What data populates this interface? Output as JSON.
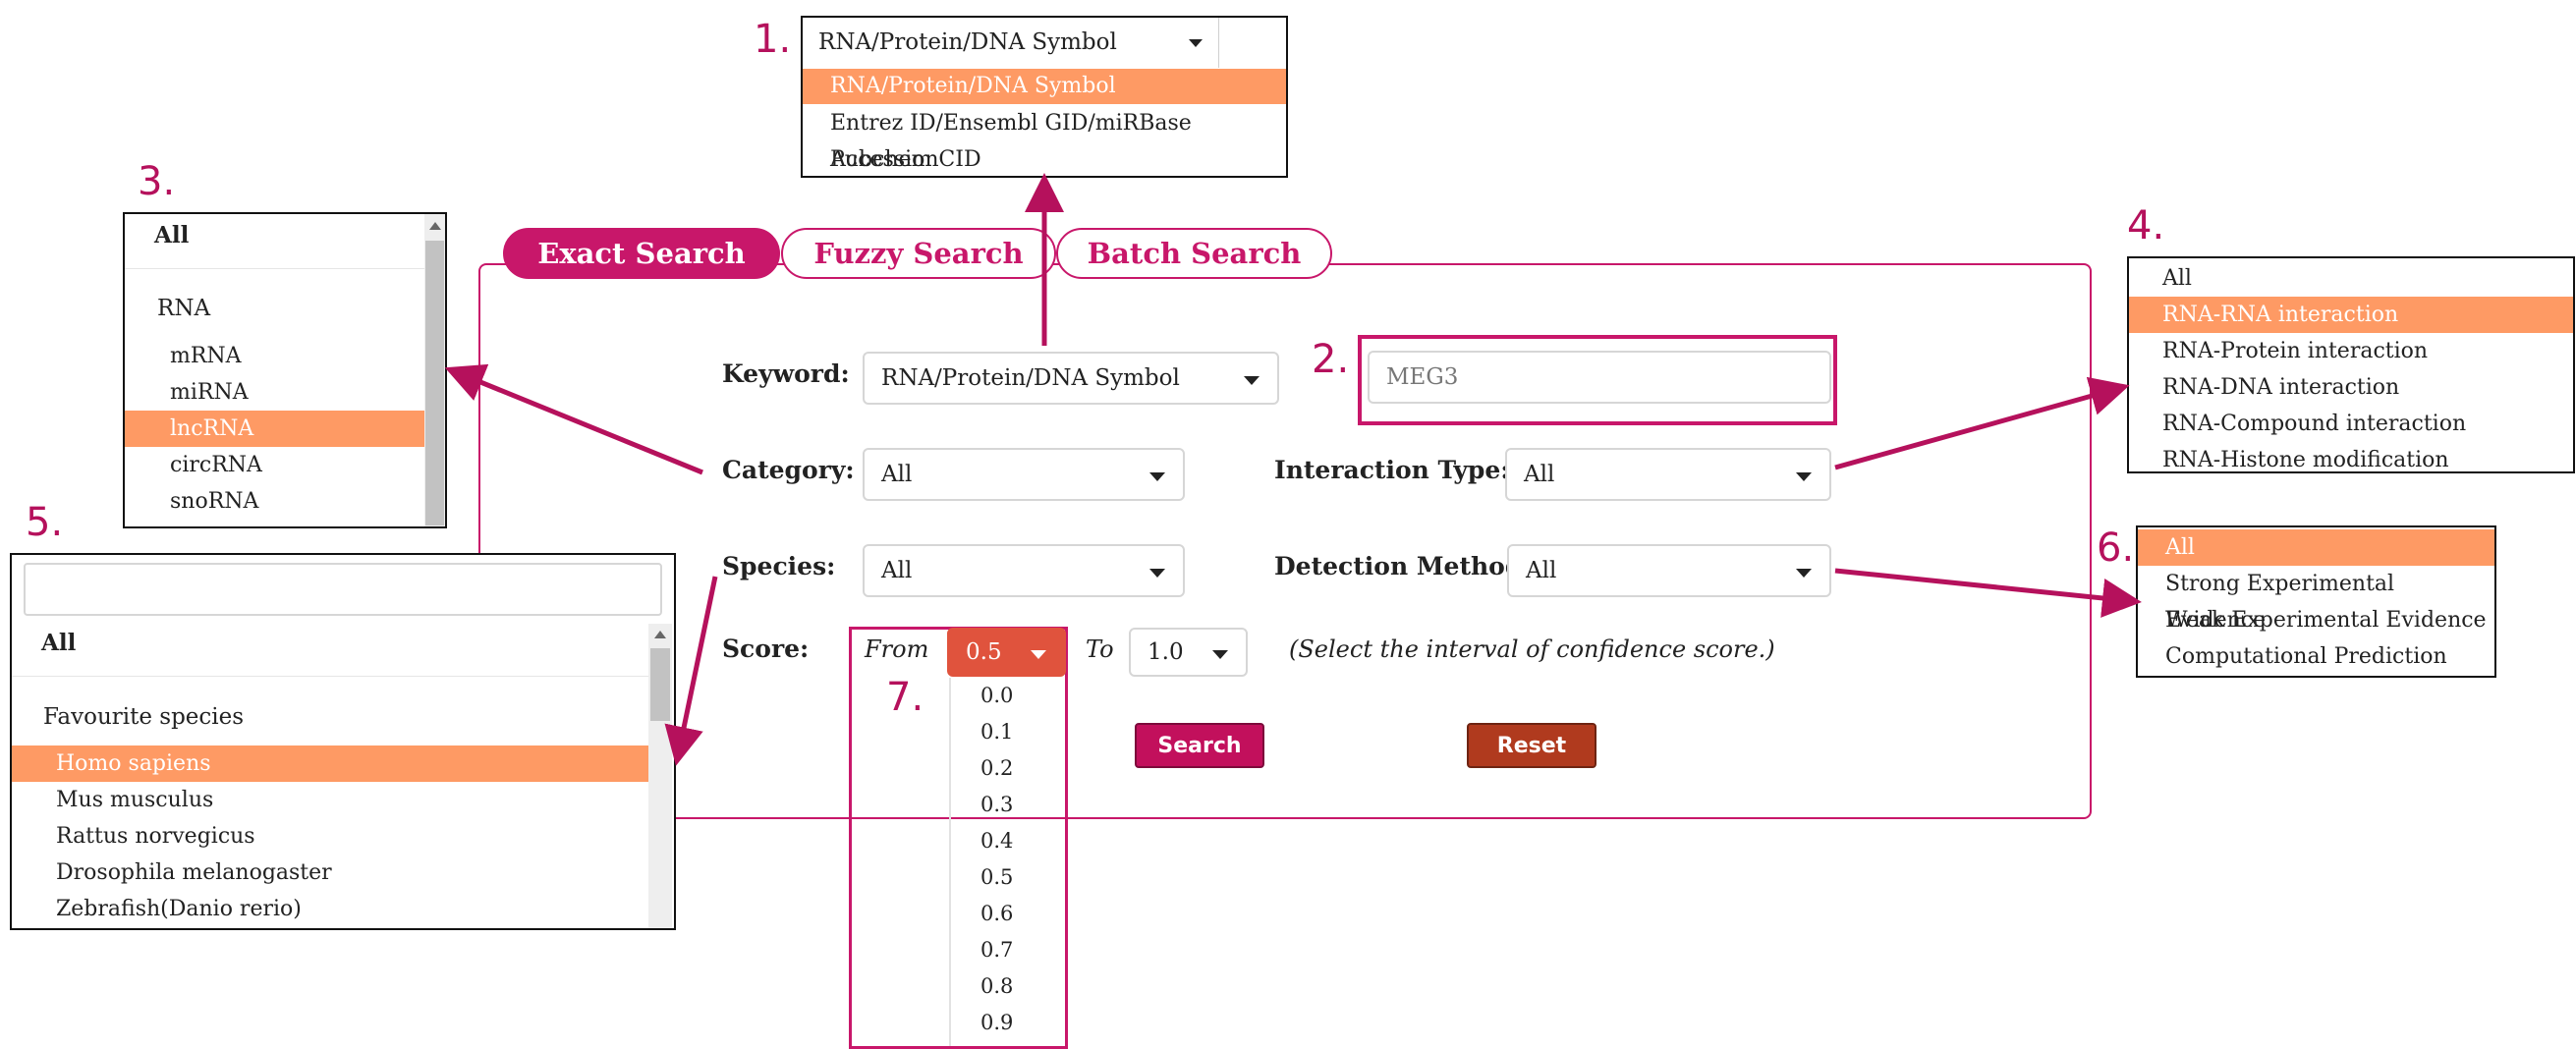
{
  "annotations": [
    "1.",
    "2.",
    "3.",
    "4.",
    "5.",
    "6.",
    "7."
  ],
  "tabs": [
    {
      "label": "Exact Search",
      "active": true
    },
    {
      "label": "Fuzzy Search",
      "active": false
    },
    {
      "label": "Batch Search",
      "active": false
    }
  ],
  "form": {
    "keyword_label": "Keyword:",
    "keyword_value": "RNA/Protein/DNA Symbol",
    "keyword_input_value": "MEG3",
    "category_label": "Category:",
    "category_value": "All",
    "interaction_label": "Interaction Type:",
    "interaction_value": "All",
    "species_label": "Species:",
    "species_value": "All",
    "detection_label": "Detection Method:",
    "detection_value": "All",
    "score_label": "Score:",
    "from_label": "From",
    "from_value": "0.5",
    "to_label": "To",
    "to_value": "1.0",
    "score_hint": "(Select the interval of confidence score.)",
    "search_button": "Search",
    "reset_button": "Reset"
  },
  "keyword_dropdown": {
    "selected": "RNA/Protein/DNA Symbol",
    "options": [
      "RNA/Protein/DNA Symbol",
      "Entrez ID/Ensembl GID/miRBase Accession",
      "Pubchem CID"
    ],
    "highlighted_index": 0
  },
  "category_dropdown": {
    "all": "All",
    "group": "RNA",
    "options": [
      "mRNA",
      "miRNA",
      "lncRNA",
      "circRNA",
      "snoRNA"
    ],
    "highlighted_index": 2
  },
  "interaction_dropdown": {
    "options": [
      "All",
      "RNA-RNA interaction",
      "RNA-Protein interaction",
      "RNA-DNA interaction",
      "RNA-Compound interaction",
      "RNA-Histone modification interaction"
    ],
    "highlighted_index": 1
  },
  "species_dropdown": {
    "all": "All",
    "group": "Favourite species",
    "options": [
      "Homo sapiens",
      "Mus musculus",
      "Rattus norvegicus",
      "Drosophila melanogaster",
      "Zebrafish(Danio rerio)"
    ],
    "highlighted_index": 0
  },
  "detection_dropdown": {
    "options": [
      "All",
      "Strong Experimental Evidence",
      "Weak Experimental Evidence",
      "Computational Prediction"
    ],
    "highlighted_index": 0
  },
  "score_dropdown": {
    "options": [
      "0.0",
      "0.1",
      "0.2",
      "0.3",
      "0.4",
      "0.5",
      "0.6",
      "0.7",
      "0.8",
      "0.9"
    ]
  },
  "colors": {
    "accent": "#c8176a",
    "highlight": "#fe9a64",
    "reset": "#b03a1e",
    "score_select": "#e0533d"
  }
}
